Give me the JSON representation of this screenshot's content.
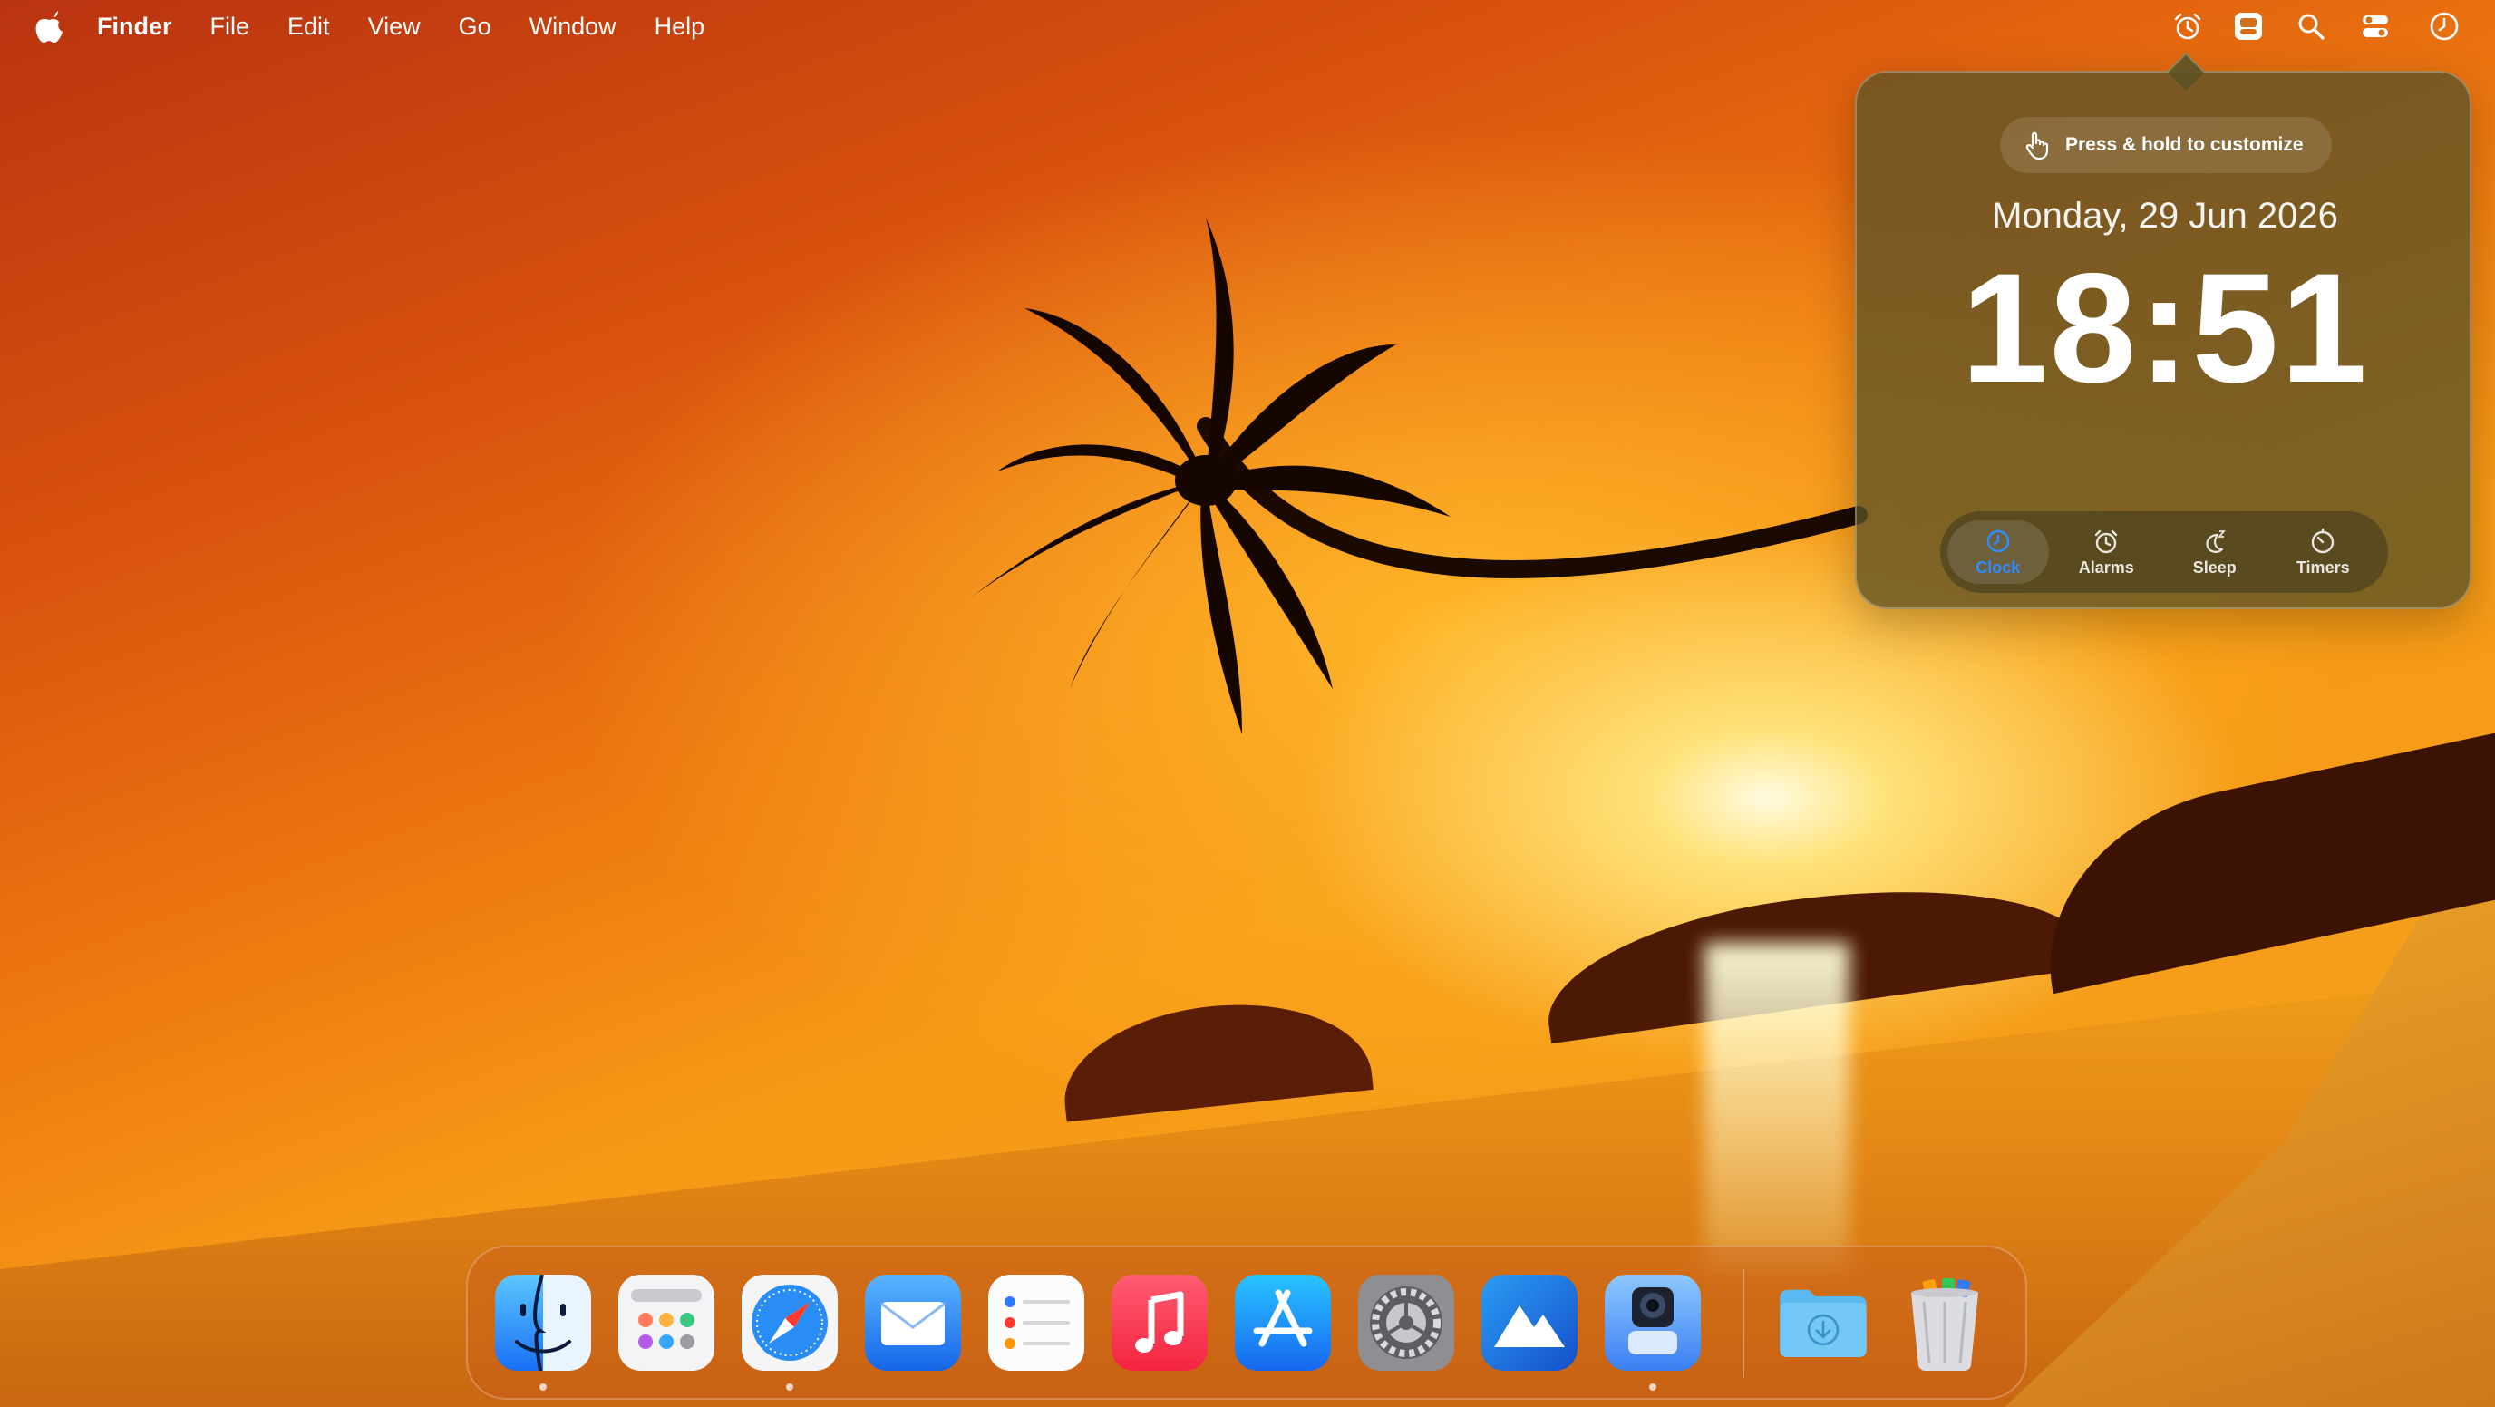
{
  "menubar": {
    "app_name": "Finder",
    "menus": [
      "File",
      "Edit",
      "View",
      "Go",
      "Window",
      "Help"
    ],
    "status_icons": [
      "alarm-clock-icon",
      "menu-extra-icon",
      "search-icon",
      "control-center-icon",
      "clock-icon"
    ]
  },
  "clock_widget": {
    "customize_hint": "Press & hold to customize",
    "date": "Monday, 29 Jun 2026",
    "time": "18:51",
    "tabs": [
      {
        "label": "Clock",
        "icon": "clock-icon",
        "active": true
      },
      {
        "label": "Alarms",
        "icon": "alarm-icon",
        "active": false
      },
      {
        "label": "Sleep",
        "icon": "sleep-icon",
        "active": false
      },
      {
        "label": "Timers",
        "icon": "timer-icon",
        "active": false
      }
    ],
    "accent_color": "#2f8cff"
  },
  "dock": {
    "apps": [
      {
        "name": "Finder",
        "icon": "finder-icon",
        "running": true
      },
      {
        "name": "Launchpad",
        "icon": "launchpad-icon",
        "running": false
      },
      {
        "name": "Safari",
        "icon": "safari-icon",
        "running": true
      },
      {
        "name": "Mail",
        "icon": "mail-icon",
        "running": false
      },
      {
        "name": "Reminders",
        "icon": "reminders-icon",
        "running": false
      },
      {
        "name": "Music",
        "icon": "music-icon",
        "running": false
      },
      {
        "name": "App Store",
        "icon": "app-store-icon",
        "running": false
      },
      {
        "name": "System Settings",
        "icon": "system-settings-icon",
        "running": false
      },
      {
        "name": "macOS Installer",
        "icon": "mountain-icon",
        "running": false
      },
      {
        "name": "Preview",
        "icon": "preview-icon",
        "running": true
      }
    ],
    "extras": [
      {
        "name": "Downloads",
        "icon": "downloads-folder-icon"
      },
      {
        "name": "Trash",
        "icon": "trash-icon"
      }
    ]
  }
}
